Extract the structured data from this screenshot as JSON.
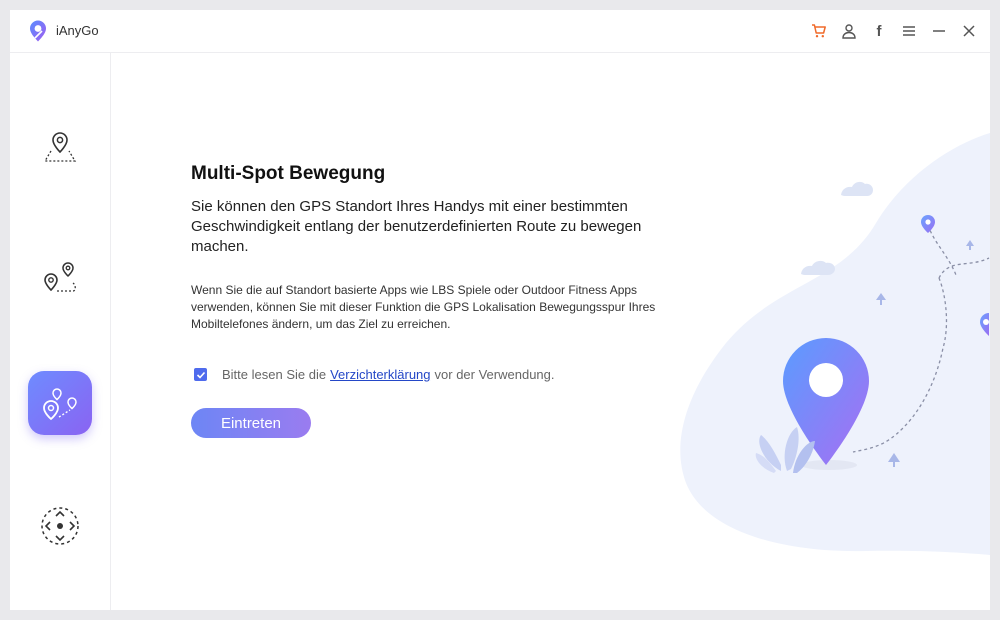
{
  "app": {
    "name": "iAnyGo"
  },
  "titlebar_icons": [
    "cart-icon",
    "user-icon",
    "facebook-icon",
    "menu-icon",
    "minimize-icon",
    "close-icon"
  ],
  "titlebar_facebook_glyph": "f",
  "sidebar": {
    "items": [
      {
        "name": "change-location",
        "icon": "location-pin-map-icon",
        "active": false
      },
      {
        "name": "single-spot",
        "icon": "two-spot-route-icon",
        "active": false
      },
      {
        "name": "multi-spot",
        "icon": "multi-spot-route-icon",
        "active": true
      },
      {
        "name": "joystick",
        "icon": "joystick-icon",
        "active": false
      }
    ]
  },
  "main": {
    "heading": "Multi-Spot Bewegung",
    "subtitle": "Sie können den GPS Standort Ihres Handys mit einer bestimmten Geschwindigkeit entlang der benutzerdefinierten Route zu bewegen machen.",
    "description": "Wenn Sie die auf Standort basierte Apps wie LBS Spiele oder Outdoor Fitness Apps verwenden, können Sie mit dieser Funktion die GPS Lokalisation Bewegungsspur Ihres Mobiltelefones ändern, um das Ziel zu erreichen.",
    "agreement": {
      "checked": true,
      "prefix": "Bitte lesen Sie die",
      "link": "Verzichterklärung",
      "suffix": "vor der Verwendung."
    },
    "enter_button": "Eintreten"
  },
  "colors": {
    "accent": "#4f6bed",
    "cart": "#f06a2a",
    "gradient_start": "#6e8cff",
    "gradient_end": "#8a63f2",
    "link": "#2447c7"
  }
}
